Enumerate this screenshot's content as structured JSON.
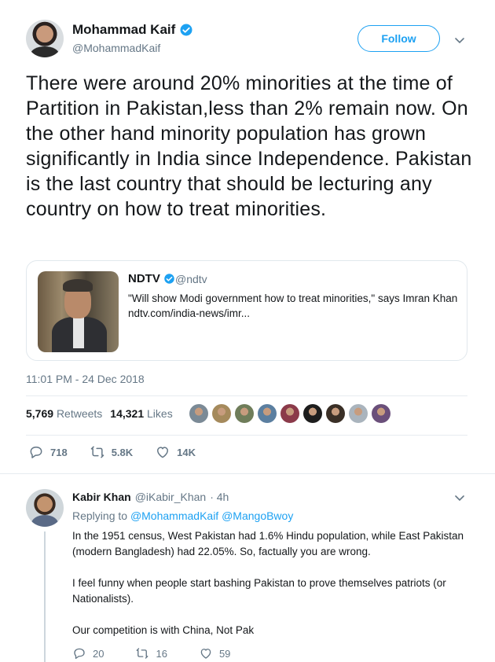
{
  "tweet": {
    "author_name": "Mohammad Kaif",
    "author_handle": "@MohammadKaif",
    "follow_label": "Follow",
    "text": "There were around 20% minorities at the time of Partition in Pakistan,less than 2% remain now. On the other hand minority population has grown significantly in India since Independence. Pakistan is the last country that should be lecturing any country on how to treat minorities.",
    "quote": {
      "name": "NDTV",
      "handle": "@ndtv",
      "text": "\"Will show Modi government how to treat minorities,\" says Imran Khan ndtv.com/india-news/imr..."
    },
    "timestamp": "11:01 PM - 24 Dec 2018",
    "retweets_count": "5,769",
    "retweets_label": "Retweets",
    "likes_count": "14,321",
    "likes_label": "Likes",
    "actions": {
      "replies": "718",
      "retweets": "5.8K",
      "likes": "14K"
    },
    "liker_avatar_colors": [
      "#7b8a96",
      "#a58a5c",
      "#6f7d5a",
      "#5b7fa0",
      "#8b3a4a",
      "#1d1d1d",
      "#3a2f26",
      "#aab4bd",
      "#6a4f7a"
    ]
  },
  "reply": {
    "author_name": "Kabir Khan",
    "author_handle": "@iKabir_Khan",
    "time": "· 4h",
    "replying_to_label": "Replying to",
    "mentions": "@MohammadKaif @MangoBwoy",
    "paragraphs": [
      "In the 1951 census, West Pakistan had 1.6% Hindu population, while East Pakistan (modern Bangladesh) had 22.05%. So,  factually you are wrong.",
      "I feel funny when people start bashing Pakistan to prove themselves patriots (or Nationalists).",
      "Our competition is with China, Not Pak"
    ],
    "actions": {
      "replies": "20",
      "retweets": "16",
      "likes": "59"
    }
  },
  "colors": {
    "brand_blue": "#1da1f2",
    "secondary_text": "#657786",
    "primary_text": "#14171a",
    "border": "#e1e8ed"
  }
}
